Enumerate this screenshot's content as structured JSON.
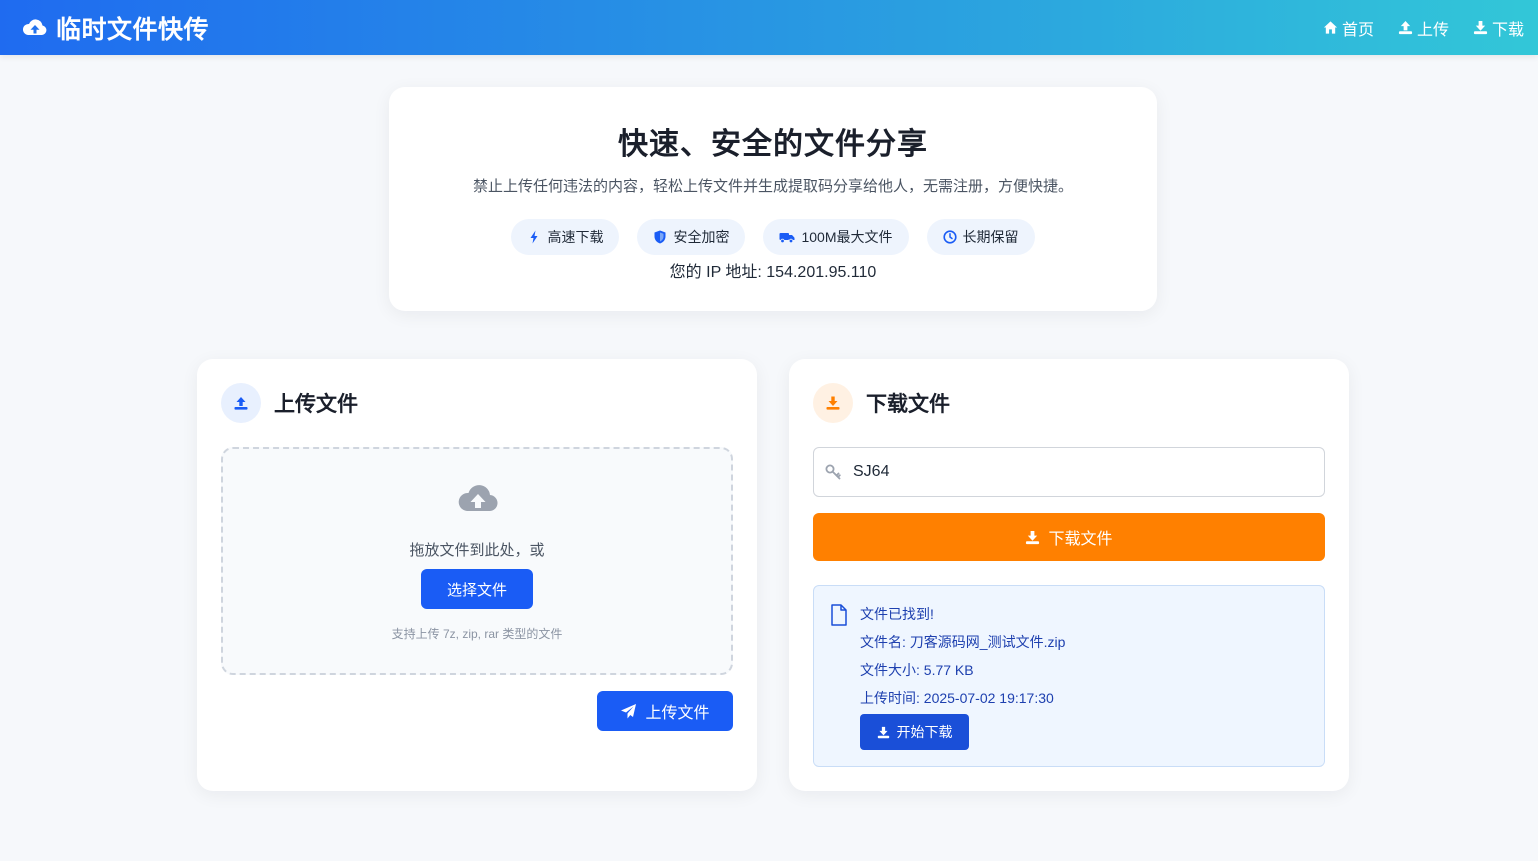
{
  "header": {
    "brand": "临时文件快传",
    "nav": [
      {
        "label": "首页",
        "icon": "home-icon"
      },
      {
        "label": "上传",
        "icon": "upload-icon"
      },
      {
        "label": "下载",
        "icon": "download-icon"
      }
    ]
  },
  "hero": {
    "title": "快速、安全的文件分享",
    "subtitle": "禁止上传任何违法的内容，轻松上传文件并生成提取码分享给他人，无需注册，方便快捷。",
    "features": [
      {
        "label": "高速下载",
        "icon": "bolt-icon"
      },
      {
        "label": "安全加密",
        "icon": "shield-icon"
      },
      {
        "label": "100M最大文件",
        "icon": "truck-icon"
      },
      {
        "label": "长期保留",
        "icon": "clock-icon"
      }
    ],
    "ip_text": "您的 IP 地址: 154.201.95.110"
  },
  "upload": {
    "title": "上传文件",
    "drop_text": "拖放文件到此处，或",
    "select_label": "选择文件",
    "hint": "支持上传 7z, zip, rar 类型的文件",
    "upload_label": "上传文件"
  },
  "download": {
    "title": "下载文件",
    "code_value": "SJ64",
    "download_label": "下载文件",
    "result": {
      "status": "文件已找到!",
      "filename": "文件名: 刀客源码网_测试文件.zip",
      "size": "文件大小: 5.77 KB",
      "time": "上传时间: 2025-07-02 19:17:30",
      "start_label": "开始下载"
    }
  },
  "colors": {
    "primary": "#1a5cf5",
    "accent": "#ff8000",
    "header_start": "#1f6bf0",
    "header_end": "#32c7d8"
  }
}
